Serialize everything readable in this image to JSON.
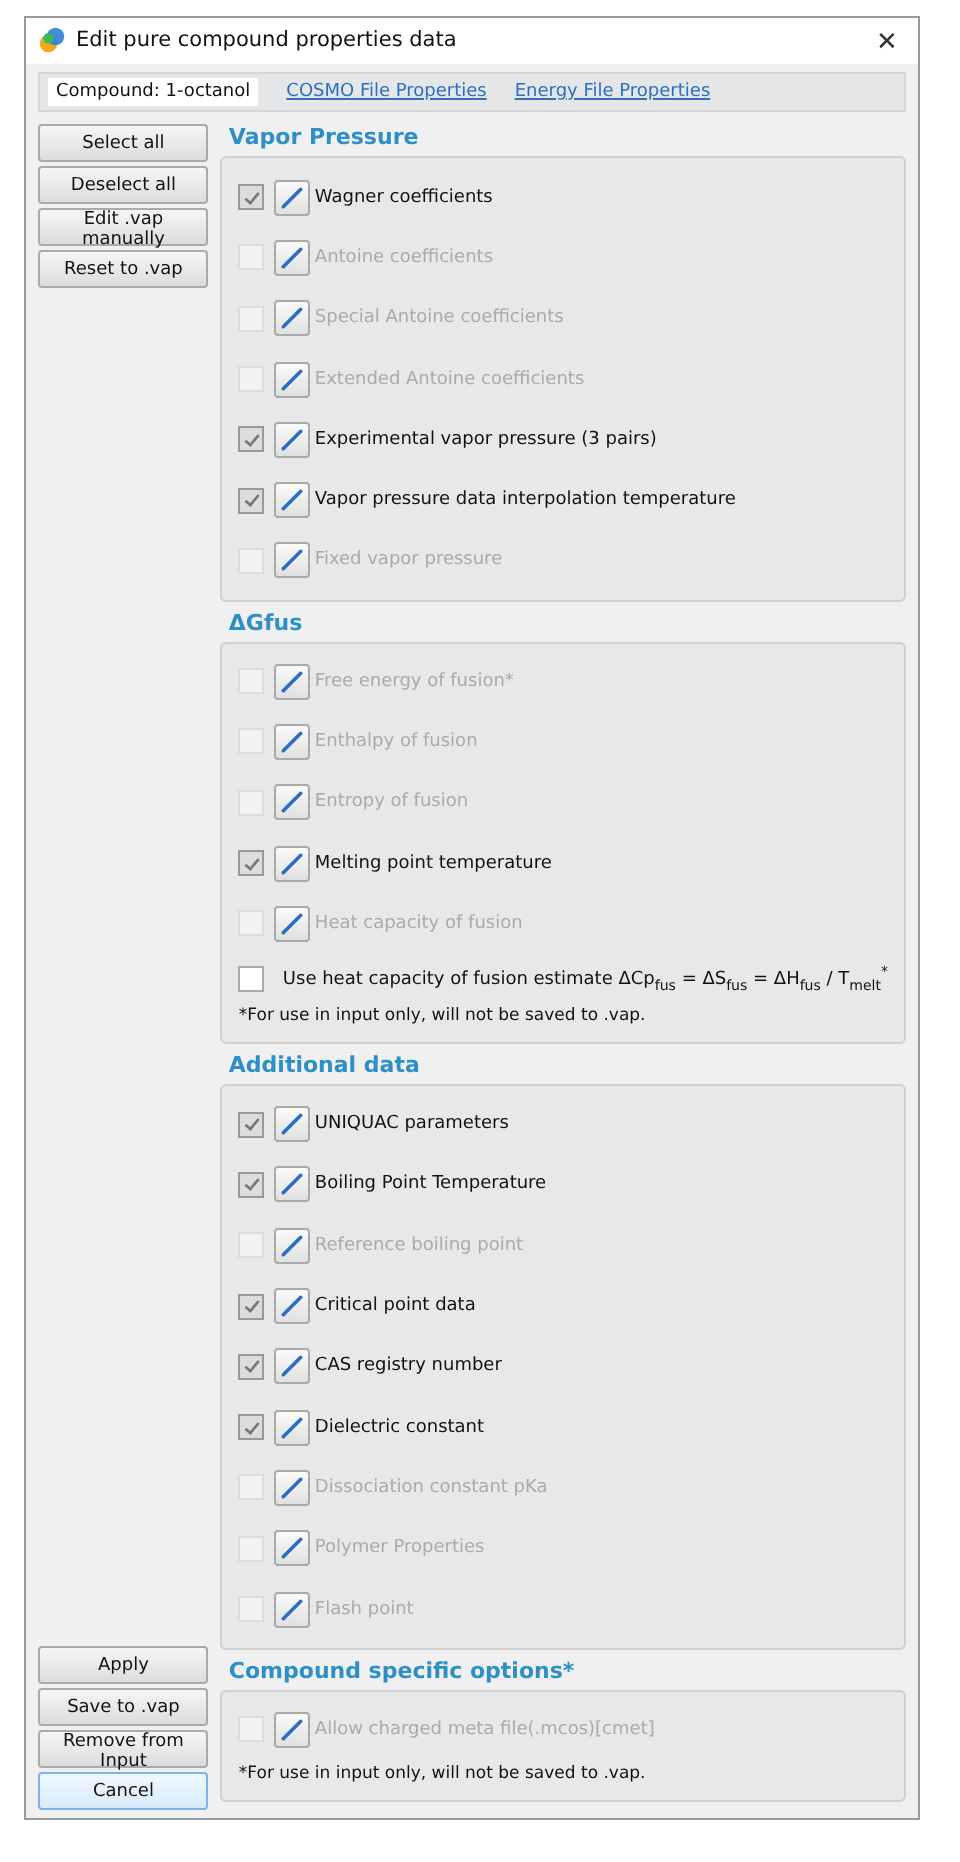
{
  "window": {
    "title": "Edit pure compound properties data",
    "close": "✕"
  },
  "tabs": [
    {
      "label": "Compound:  1-octanol",
      "kind": "label"
    },
    {
      "label": "COSMO File Properties",
      "kind": "link"
    },
    {
      "label": "Energy File Properties",
      "kind": "link"
    }
  ],
  "side_buttons_top": [
    {
      "label": "Select all",
      "focused": false
    },
    {
      "label": "Deselect all",
      "focused": false
    },
    {
      "label": "Edit .vap manually",
      "focused": false
    },
    {
      "label": "Reset to .vap",
      "focused": false
    }
  ],
  "side_buttons_bottom": [
    {
      "label": "Apply",
      "focused": false
    },
    {
      "label": "Save to .vap",
      "focused": false
    },
    {
      "label": "Remove from Input",
      "focused": false
    },
    {
      "label": "Cancel",
      "focused": true
    }
  ],
  "sections": [
    {
      "title": "Vapor Pressure",
      "items": [
        {
          "kind": "option",
          "label": "Wagner coefficients",
          "checked": true,
          "disabled": false
        },
        {
          "kind": "option",
          "label": "Antoine coefficients",
          "checked": false,
          "disabled": true
        },
        {
          "kind": "option",
          "label": "Special Antoine coefficients",
          "checked": false,
          "disabled": true
        },
        {
          "kind": "option",
          "label": "Extended Antoine coefficients",
          "checked": false,
          "disabled": true
        },
        {
          "kind": "option",
          "label": "Experimental vapor pressure  (3 pairs)",
          "checked": true,
          "disabled": false
        },
        {
          "kind": "option",
          "label": "Vapor pressure data interpolation temperature",
          "checked": true,
          "disabled": false
        },
        {
          "kind": "option",
          "label": "Fixed vapor pressure",
          "checked": false,
          "disabled": true
        }
      ]
    },
    {
      "title": "ΔGfus",
      "items": [
        {
          "kind": "option",
          "label": "Free energy of fusion*",
          "checked": false,
          "disabled": true
        },
        {
          "kind": "option",
          "label": "Enthalpy of fusion",
          "checked": false,
          "disabled": true
        },
        {
          "kind": "option",
          "label": "Entropy of fusion",
          "checked": false,
          "disabled": true
        },
        {
          "kind": "option",
          "label": "Melting point temperature",
          "checked": true,
          "disabled": false
        },
        {
          "kind": "option",
          "label": "Heat capacity of fusion",
          "checked": false,
          "disabled": true
        },
        {
          "kind": "checkbox",
          "label": "Use heat capacity of fusion estimate ΔCp$_{fus}$ = ΔS$_{fus}$ = ΔH$_{fus}$ / T$_{melt}$$^{*}$",
          "checked": false
        },
        {
          "kind": "note",
          "label": "*For use in input only, will not be saved to .vap."
        }
      ]
    },
    {
      "title": "Additional data",
      "items": [
        {
          "kind": "option",
          "label": "UNIQUAC parameters",
          "checked": true,
          "disabled": false
        },
        {
          "kind": "option",
          "label": "Boiling Point Temperature",
          "checked": true,
          "disabled": false
        },
        {
          "kind": "option",
          "label": "Reference boiling point",
          "checked": false,
          "disabled": true
        },
        {
          "kind": "option",
          "label": "Critical point data",
          "checked": true,
          "disabled": false
        },
        {
          "kind": "option",
          "label": "CAS registry number",
          "checked": true,
          "disabled": false
        },
        {
          "kind": "option",
          "label": "Dielectric constant",
          "checked": true,
          "disabled": false
        },
        {
          "kind": "option",
          "label": "Dissociation constant pKa",
          "checked": false,
          "disabled": true
        },
        {
          "kind": "option",
          "label": "Polymer Properties",
          "checked": false,
          "disabled": true
        },
        {
          "kind": "option",
          "label": "Flash point",
          "checked": false,
          "disabled": true
        }
      ]
    },
    {
      "title": "Compound specific options*",
      "items": [
        {
          "kind": "option",
          "label": "Allow charged meta file(.mcos)[cmet]",
          "checked": false,
          "disabled": true
        },
        {
          "kind": "note",
          "label": "*For use in input only, will not be saved to .vap."
        }
      ]
    }
  ]
}
